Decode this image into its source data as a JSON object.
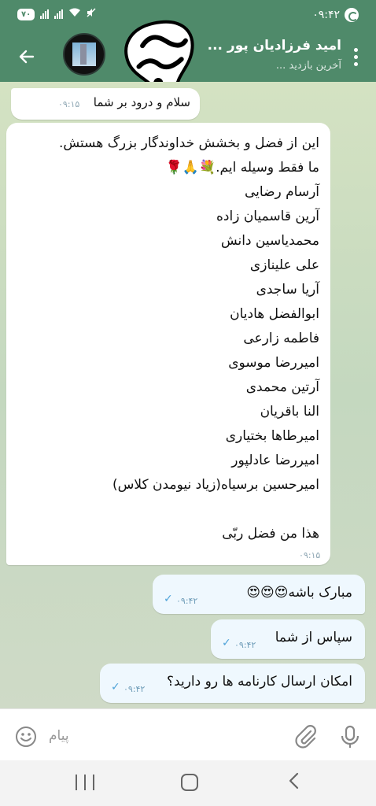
{
  "status_bar": {
    "battery": "۷۰",
    "time": "۰۹:۴۲"
  },
  "header": {
    "title": "امید فرزادیان پور ...",
    "subtitle": "آخرین بازدید ..."
  },
  "messages": [
    {
      "direction": "in",
      "text": "سلام و درود بر شما",
      "time": "۰۹:۱۵"
    },
    {
      "direction": "in",
      "lines": [
        "این از فضل و بخشش خداوندگار بزرگ هستش.",
        "ما فقط وسیله ایم.💐🙏🌹",
        "آرسام رضایی",
        "آرین قاسمیان زاده",
        "محمدیاسین دانش",
        "علی علینازی",
        "آریا ساجدی",
        "ابوالفضل هادیان",
        "فاطمه زارعی",
        "امیررضا موسوی",
        "آرتین محمدی",
        "النا باقریان",
        "امیرطاها بختیاری",
        "امیررضا عادلپور",
        "امیرحسین برسیاه(زیاد نیومدن کلاس)",
        "",
        "هذا من فضل ربّی"
      ],
      "time": "۰۹:۱۵"
    },
    {
      "direction": "out",
      "text": "مبارک باشه😍😍😍",
      "time": "۰۹:۴۲",
      "status": "✓"
    },
    {
      "direction": "out",
      "text": "سپاس از شما",
      "time": "۰۹:۴۲",
      "status": "✓"
    },
    {
      "direction": "out",
      "text": "امکان ارسال کارنامه ها رو دارید؟",
      "time": "۰۹:۴۲",
      "status": "✓"
    }
  ],
  "input": {
    "placeholder": "پیام"
  },
  "icons": {
    "back": "arrow-left-icon",
    "menu": "kebab-menu-icon",
    "emoji": "smiley-icon",
    "attach": "paperclip-icon",
    "mic": "microphone-icon"
  },
  "colors": {
    "header": "#4f8a6a",
    "outgoing_bubble": "#eff8fe",
    "incoming_bubble": "#ffffff",
    "check": "#4fa3d9"
  }
}
